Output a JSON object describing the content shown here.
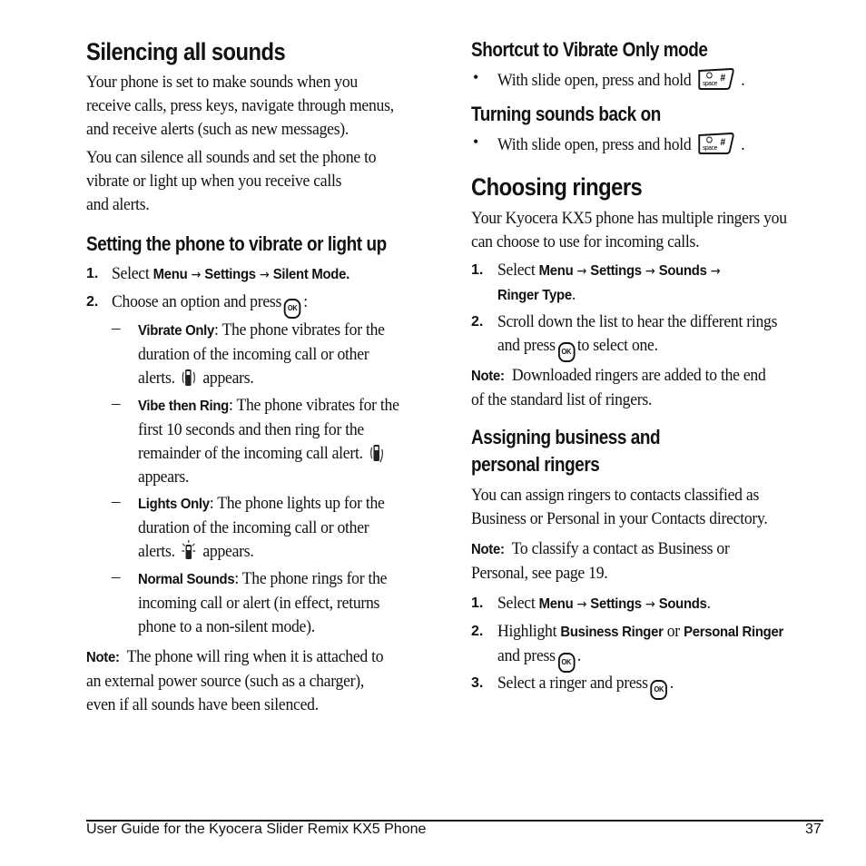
{
  "left": {
    "title": "Silencing all sounds",
    "intro1": [
      "Your phone is set to make sounds when you",
      "receive calls, press keys, navigate through menus,",
      "and receive alerts (such as new messages)."
    ],
    "intro2": [
      "You can silence all sounds and set the phone to",
      "vibrate  or light up when you receive calls",
      "and alerts."
    ],
    "subheading": "Setting the phone to vibrate or light up",
    "steps": [
      {
        "num": "1.",
        "text": "Select ",
        "path": [
          "Menu",
          "Settings",
          "Silent Mode"
        ],
        "end": "."
      },
      {
        "num": "2.",
        "text": "Choose an option and press",
        "key": "OK",
        "end": ":"
      }
    ],
    "options": [
      {
        "label": "Vibrate Only",
        "lines": [
          ": The phone vibrates for the",
          "duration of the incoming call or other",
          "alerts.",
          "appears."
        ],
        "icon": "vibrate-icon"
      },
      {
        "label": "Vibe then Ring",
        "lines": [
          ": The phone vibrates for the",
          "first 10 seconds and then ring for the",
          "remainder of the incoming call alert.",
          "appears."
        ],
        "icon": "vibe-ring-icon"
      },
      {
        "label": "Lights Only",
        "lines": [
          ": The phone lights up for the",
          "duration of the incoming call or other",
          "alerts.",
          "appears."
        ],
        "icon": "lights-icon"
      },
      {
        "label": "Normal Sounds",
        "lines": [
          ": The phone rings for the",
          "incoming call or alert (in effect, returns",
          "phone to a non-silent mode)."
        ]
      }
    ],
    "note_label": "Note:",
    "note_lines": [
      "The phone will ring when it is attached to",
      "an external power source (such as a charger),",
      "even if all sounds have been silenced."
    ]
  },
  "right": {
    "shortcut_heading": "Shortcut to Vibrate Only mode",
    "shortcut_bullet": "With slide open, press and hold",
    "shortcut_key": "space #",
    "turning_heading": "Turning sounds back on",
    "turning_bullet": "With slide open, press and hold",
    "title": "Choosing ringers",
    "intro": [
      "Your Kyocera KX5 phone has multiple ringers you",
      "can choose to use for incoming calls."
    ],
    "steps": [
      {
        "num": "1.",
        "text": "Select ",
        "path": [
          "Menu",
          "Settings",
          "Sounds",
          "Ringer Type"
        ],
        "end": "."
      },
      {
        "num": "2.",
        "lines": [
          "Scroll down the list to hear the different rings",
          "and press",
          "to select one."
        ],
        "key": "OK"
      }
    ],
    "note1_label": "Note:",
    "note1_lines": [
      "Downloaded ringers are added to the end",
      "of the standard list of ringers."
    ],
    "assign_heading": [
      "Assigning business and",
      "personal ringers"
    ],
    "assign_intro": [
      "You can assign ringers to contacts classified as",
      "Business or Personal in your Contacts directory."
    ],
    "note2_label": "Note:",
    "note2_lines": [
      "To classify a contact as Business or",
      "Personal, see page 19."
    ],
    "assign_steps": [
      {
        "num": "1.",
        "text": "Select ",
        "path": [
          "Menu",
          "Settings",
          "Sounds"
        ],
        "end": "."
      },
      {
        "num": "2.",
        "pre": "Highlight ",
        "bold1": "Business Ringer",
        "mid": " or ",
        "bold2": "Personal Ringer",
        "line2": "and press",
        "key": "OK",
        "end": "."
      },
      {
        "num": "3.",
        "text": "Select a ringer and press",
        "key": "OK",
        "end": "."
      }
    ]
  },
  "footer": {
    "guide_title": "User Guide for the Kyocera Slider Remix KX5 Phone",
    "page_number": "37"
  },
  "arrow": "→"
}
